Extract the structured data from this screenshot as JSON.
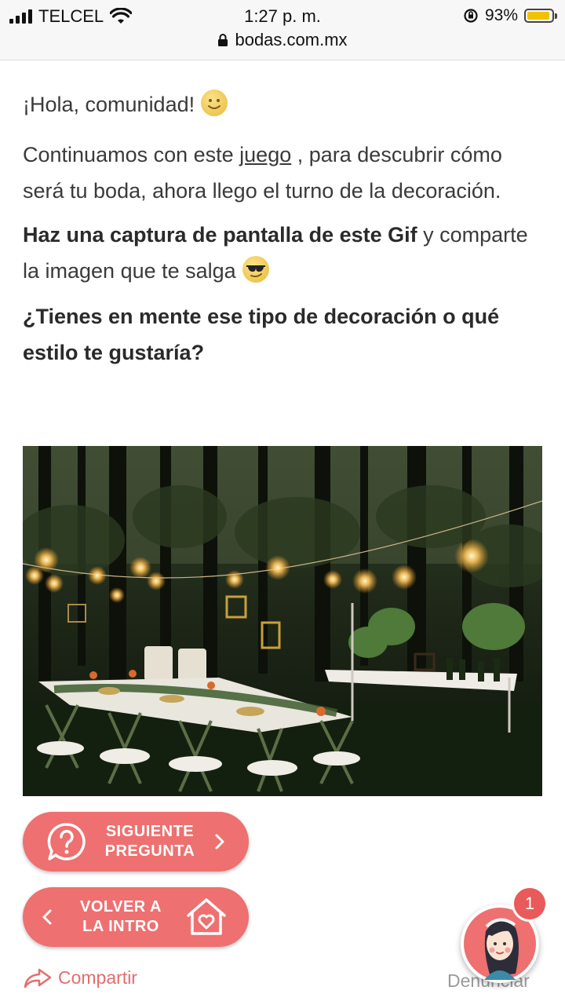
{
  "status_bar": {
    "carrier": "TELCEL",
    "time": "1:27 p. m.",
    "battery": "93%",
    "battery_level": 0.93,
    "url": "bodas.com.mx"
  },
  "post": {
    "greeting": "¡Hola, comunidad!",
    "intro_before": "Continuamos con este ",
    "intro_link": "juego",
    "intro_after": " , para descubrir cómo será tu boda, ahora llego el turno de la decoración.",
    "instruction_bold": "Haz una captura de pantalla de este Gif",
    "instruction_rest": " y comparte la imagen que te salga",
    "question": "¿Tienes en mente ese tipo de decoración o qué estilo te gustaría?"
  },
  "buttons": {
    "next_line1": "SIGUIENTE",
    "next_line2": "PREGUNTA",
    "back_line1": "VOLVER A",
    "back_line2": "LA INTRO"
  },
  "footer": {
    "share": "Compartir",
    "report": "Denunciar"
  },
  "chat": {
    "badge": "1"
  },
  "colors": {
    "accent": "#ee7070",
    "share": "#e56d6d"
  },
  "icons": [
    "signal-icon",
    "wifi-icon",
    "lock-icon",
    "orientation-lock-icon",
    "battery-icon",
    "question-icon",
    "chevron-right-icon",
    "chevron-left-icon",
    "home-heart-icon",
    "share-icon",
    "smile-emoji",
    "sunglasses-emoji"
  ]
}
